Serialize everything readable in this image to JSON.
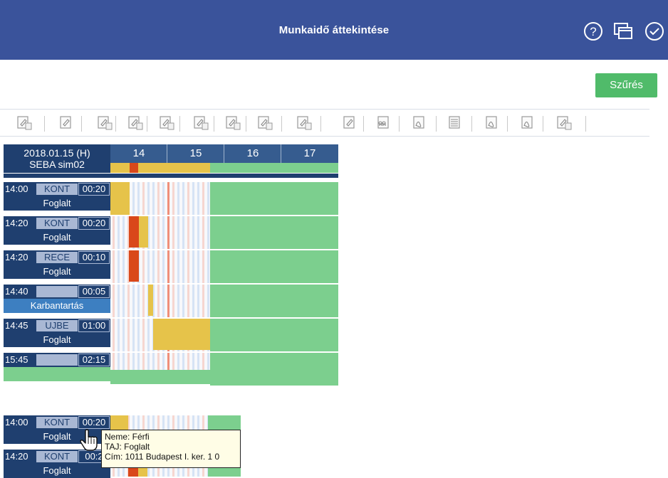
{
  "header": {
    "title": "Munkaidő áttekintése",
    "icons": [
      "help-icon",
      "window-icon",
      "check-icon"
    ]
  },
  "filter": {
    "label": "Szűrés"
  },
  "toolbar": {
    "icons": [
      "edit-lock-icon",
      "edit-icon",
      "copy-doc-icon",
      "add-lock-icon",
      "edit-lock-icon",
      "copy-add-icon",
      "copy-edit-icon",
      "copy-edit-add-icon",
      "doc-add-icon",
      "edit-icon",
      "people-doc-icon",
      "pdf-icon",
      "stack-icon",
      "pdf-icon",
      "pdf-icon",
      "doc-lock-icon"
    ]
  },
  "timeline": {
    "date": "2018.01.15 (H)",
    "resource": "SEBA sim02",
    "hours": [
      "14",
      "15",
      "16",
      "17"
    ]
  },
  "appointments": [
    {
      "time": "14:00",
      "type": "KONT",
      "duration": "00:20",
      "status": "Foglalt"
    },
    {
      "time": "14:20",
      "type": "KONT",
      "duration": "00:20",
      "status": "Foglalt"
    },
    {
      "time": "14:20",
      "type": "RECE",
      "duration": "00:10",
      "status": "Foglalt"
    },
    {
      "time": "14:40",
      "type": "",
      "duration": "00:05",
      "status": "Karbantartás"
    },
    {
      "time": "14:45",
      "type": "UJBE",
      "duration": "01:00",
      "status": "Foglalt"
    },
    {
      "time": "15:45",
      "type": "",
      "duration": "02:15",
      "status": ""
    }
  ],
  "snippet": {
    "appointments": [
      {
        "time": "14:00",
        "type": "KONT",
        "duration": "00:20",
        "status": "Foglalt"
      },
      {
        "time": "14:20",
        "type": "KONT",
        "duration": "00:2",
        "status": "Foglalt"
      }
    ],
    "tooltip": {
      "line1": "Neme: Férfi",
      "line2": "TAJ: Foglalt",
      "line3": "Cím: 1011 Budapest I. ker. 1 0"
    }
  },
  "colors": {
    "header": "#3a539b",
    "navy": "#1f3f6f",
    "hour": "#365c8f",
    "green": "#7ccf8e",
    "yellow": "#e6c34a",
    "red": "#d9481a",
    "filter": "#50bb6a"
  }
}
